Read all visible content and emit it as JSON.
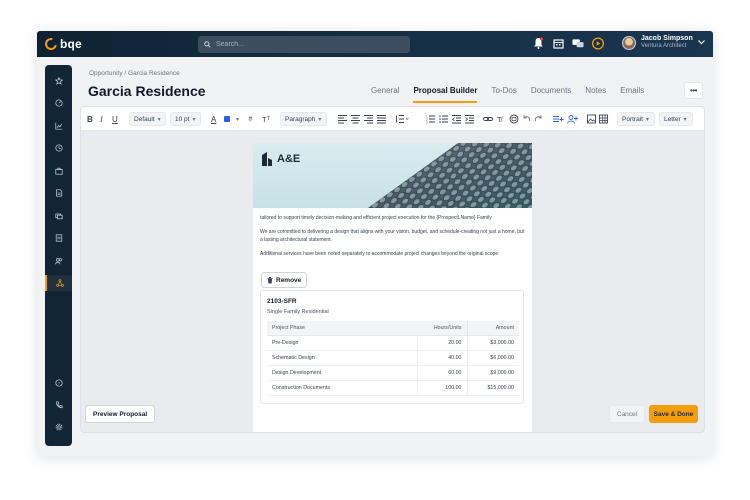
{
  "app": {
    "logo_text": "bqe",
    "brand_color": "#f59e0b"
  },
  "search": {
    "placeholder": "Search..."
  },
  "user": {
    "name": "Jacob Simpson",
    "role": "Ventura Architect"
  },
  "breadcrumb": {
    "root": "Opportunity",
    "separator": " / ",
    "current": "Garcia Residence"
  },
  "page": {
    "title": "Garcia Residence"
  },
  "tabs": [
    {
      "label": "General"
    },
    {
      "label": "Proposal Builder"
    },
    {
      "label": "To-Dos"
    },
    {
      "label": "Documents"
    },
    {
      "label": "Notes"
    },
    {
      "label": "Emails"
    }
  ],
  "more_label": "•••",
  "toolbar": {
    "font_family": "Default",
    "font_size": "10 pt",
    "paragraph": "Paragraph",
    "orientation": "Portrait",
    "paper": "Letter"
  },
  "document": {
    "brand": "A&E",
    "p1": "tailored to support timely decision-making and efficient project execution for the {ProspectLName} Family",
    "p2": "We are committed to delivering a design that aligns with your vision, budget, and schedule-creating not just a home, but a lasting architectural statement.",
    "p3": "Additional services have been noted separately to accommodate project changes beyond the original scope",
    "remove_label": "Remove",
    "phase_code": "2103-SFR",
    "phase_name": "Single Family Residential",
    "table_headers": {
      "phase": "Project Phase",
      "hours": "Hours/Units",
      "amount": "Amount"
    },
    "rows": [
      {
        "phase": "Pre-Design",
        "hours": "20.00",
        "amount": "$3,000.00"
      },
      {
        "phase": "Schematic Design",
        "hours": "40.00",
        "amount": "$6,000.00"
      },
      {
        "phase": "Design Development",
        "hours": "60.00",
        "amount": "$9,000.00"
      },
      {
        "phase": "Construction Documents",
        "hours": "100.00",
        "amount": "$15,000.00"
      }
    ]
  },
  "footer": {
    "preview": "Preview Proposal",
    "cancel": "Cancel",
    "save": "Save & Done"
  }
}
